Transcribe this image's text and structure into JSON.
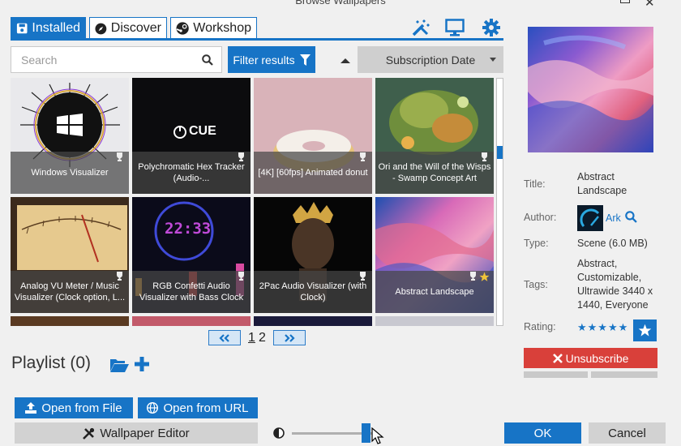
{
  "window": {
    "title": "Browse Wallpapers"
  },
  "tabs": [
    {
      "label": "Installed",
      "icon": "save-icon",
      "active": true
    },
    {
      "label": "Discover",
      "icon": "compass-icon"
    },
    {
      "label": "Workshop",
      "icon": "steam-icon"
    }
  ],
  "toolbar_icons": [
    "magic-wand-icon",
    "monitor-icon",
    "gear-icon"
  ],
  "search": {
    "placeholder": "Search",
    "value": ""
  },
  "filter": {
    "label": "Filter results"
  },
  "sort": {
    "direction": "ascending",
    "selected": "Subscription Date"
  },
  "wallpapers": [
    {
      "title": "Windows Visualizer",
      "badge": "trophy"
    },
    {
      "title": "Polychromatic Hex Tracker (Audio-...",
      "badge": "trophy",
      "logo": "CUE"
    },
    {
      "title": "[4K] [60fps] Animated donut",
      "badge": "trophy"
    },
    {
      "title": "Ori and the Will of the Wisps - Swamp Concept Art",
      "badge": "trophy"
    },
    {
      "title": "Analog VU Meter / Music Visualizer (Clock option, L...",
      "badge": "trophy"
    },
    {
      "title": "RGB Confetti Audio Visualizer with Bass Clock",
      "badge": "trophy",
      "clock": "22:33"
    },
    {
      "title": "2Pac Audio Visualizer (with Clock)",
      "badge": "trophy"
    },
    {
      "title": "Abstract Landscape",
      "badge": "trophy",
      "favorite": true,
      "selected": true
    }
  ],
  "pagination": {
    "pages": [
      "1",
      "2"
    ],
    "current": "1"
  },
  "playlist": {
    "title": "Playlist (0)"
  },
  "buttons": {
    "open_file": "Open from File",
    "open_url": "Open from URL",
    "editor": "Wallpaper Editor",
    "ok": "OK",
    "cancel": "Cancel",
    "unsubscribe": "Unsubscribe"
  },
  "brightness": {
    "value": 0.88
  },
  "details": {
    "title_label": "Title:",
    "title": "Abstract Landscape",
    "author_label": "Author:",
    "author": "Ark",
    "type_label": "Type:",
    "type": "Scene (6.0 MB)",
    "tags_label": "Tags:",
    "tags": "Abstract, Customizable, Ultrawide 3440 x 1440, Everyone",
    "rating_label": "Rating:",
    "rating_stars": "★★★★★",
    "rating": 5
  },
  "colors": {
    "accent": "#1774c6",
    "danger": "#d9403a",
    "selection": "#3a93e0"
  }
}
